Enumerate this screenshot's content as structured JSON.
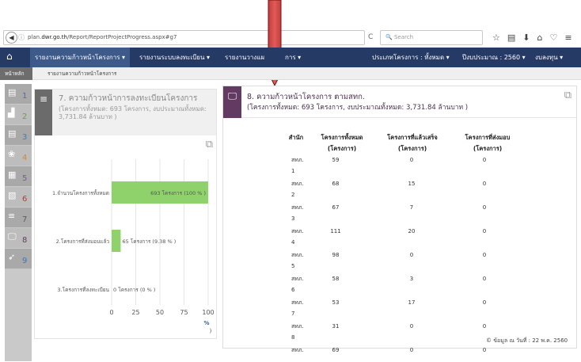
{
  "browser": {
    "url_prefix": "plan.",
    "url_domain": "dwr.go.th",
    "url_path": "/Report/ReportProjectProgress.aspx#g7",
    "search_placeholder": "Search",
    "reload_glyph": "C"
  },
  "navbar": {
    "items": [
      "รายงานความก้าวหน้าโครงการ ▾",
      "รายงานระบบลงทะเบียน ▾",
      "รายงานวางแผ",
      "การ ▾",
      "ประเภทโครงการ : ทั้งหมด ▾",
      "ปีงบประมาณ : 2560 ▾",
      "งบลงทุน ▾"
    ]
  },
  "breadcrumb": {
    "home": "หน้าหลัก",
    "current": "รายงานความก้าวหน้าโครงการ"
  },
  "leftbar": {
    "numbers": [
      "1",
      "2",
      "3",
      "4",
      "5",
      "6",
      "7",
      "8",
      "9"
    ],
    "colors": [
      "#4a6bb5",
      "#6aa33a",
      "#3b7fc4",
      "#d08a2a",
      "#7a54a8",
      "#c0392b",
      "#5c5c5c",
      "#633a62",
      "#3579c4"
    ]
  },
  "panel1": {
    "title": "7. ความก้าวหน้าการลงทะเบียนโครงการ",
    "subtitle": "(โครงการทั้งหมด: 693 โครงการ, งบประมาณทั้งหมด: 3,731.84 ล้านบาท )"
  },
  "chart_data": {
    "type": "bar",
    "orientation": "horizontal",
    "categories": [
      "1.จำนวนโครงการทั้งหมด",
      "2.โครงการที่ส่งมอบแล้ว",
      "3.โครงการที่ลงทะเบียน"
    ],
    "values": [
      100,
      9.38,
      0
    ],
    "data_labels": [
      "693 โครงการ (100 % )",
      "65 โครงการ (9.38 % )",
      "0 โครงการ (0 % )"
    ],
    "xticks": [
      "0",
      "25",
      "50",
      "75",
      "100"
    ],
    "xlim": [
      0,
      100
    ],
    "xunit": "%",
    "xunit_trailing": ")",
    "bar_color": "#8fd16a"
  },
  "panel2": {
    "title": "8. ความก้าวหน้าโครงการ ตามสทก.",
    "subtitle": "(โครงการทั้งหมด: 693 โครงการ, งบประมาณทั้งหมด: 3,731.84 ล้านบาท )",
    "headers": [
      "สำนัก",
      "โครงการทั้งหมด (โครงการ)",
      "โครงการที่แล้วเสร็จ (โครงการ)",
      "โครงการที่ส่งมอบ (โครงการ)"
    ],
    "rows": [
      {
        "office": "สทภ.",
        "num": "1",
        "total": "59",
        "done": "0",
        "delivered": "0"
      },
      {
        "office": "สทภ.",
        "num": "2",
        "total": "68",
        "done": "15",
        "delivered": "0"
      },
      {
        "office": "สทภ.",
        "num": "3",
        "total": "67",
        "done": "7",
        "delivered": "0"
      },
      {
        "office": "สทภ.",
        "num": "4",
        "total": "111",
        "done": "20",
        "delivered": "0"
      },
      {
        "office": "สทภ.",
        "num": "5",
        "total": "98",
        "done": "0",
        "delivered": "0"
      },
      {
        "office": "สทภ.",
        "num": "6",
        "total": "58",
        "done": "3",
        "delivered": "0"
      },
      {
        "office": "สทภ.",
        "num": "7",
        "total": "53",
        "done": "17",
        "delivered": "0"
      },
      {
        "office": "สทภ.",
        "num": "8",
        "total": "31",
        "done": "0",
        "delivered": "0"
      },
      {
        "office": "สทภ.",
        "num": "",
        "total": "69",
        "done": "0",
        "delivered": "0"
      }
    ],
    "footer": "© ข้อมูล ณ วันที่ : 22 พ.ค. 2560"
  }
}
